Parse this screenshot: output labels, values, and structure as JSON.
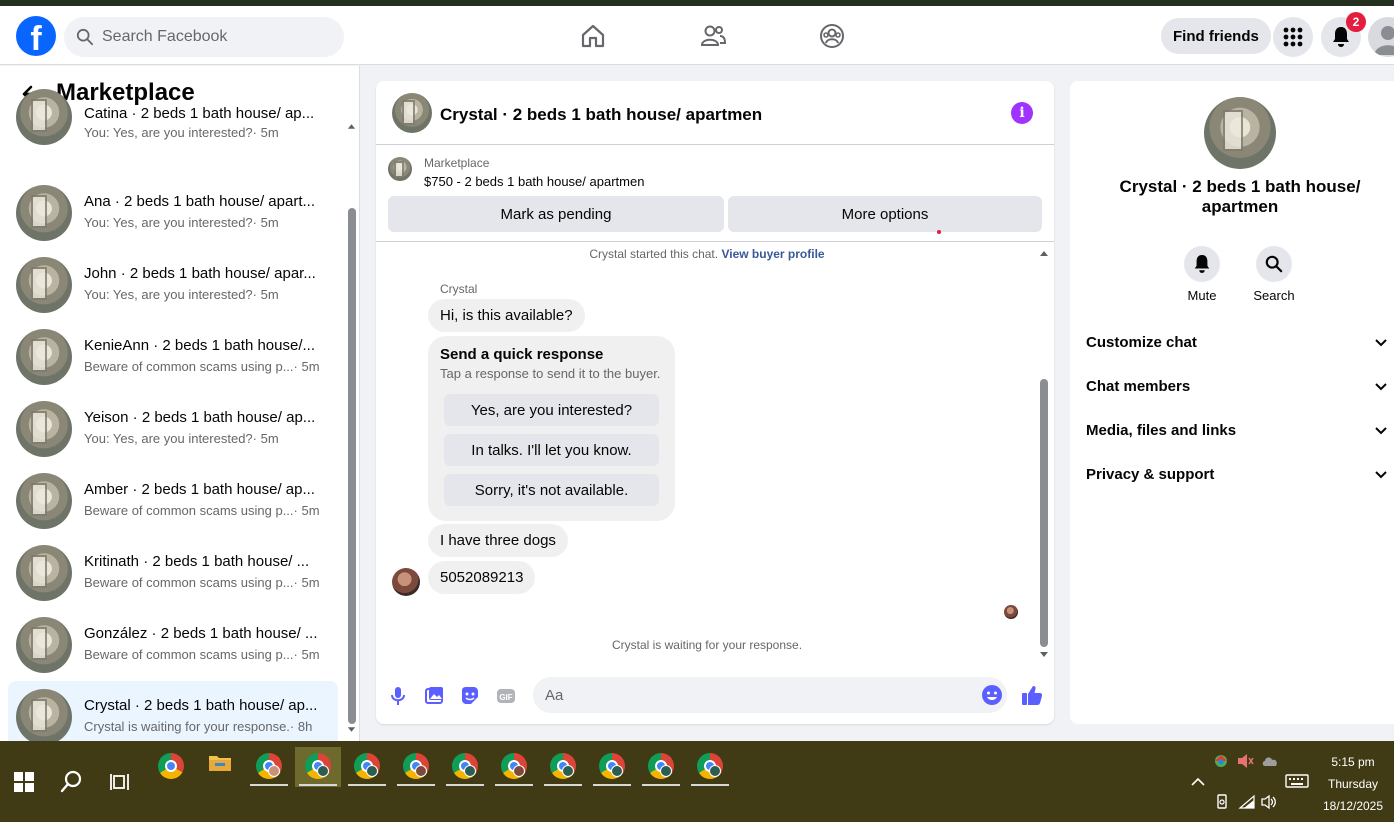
{
  "search": {
    "placeholder": "Search Facebook"
  },
  "header": {
    "find_friends": "Find friends",
    "notifications_count": "2"
  },
  "sidebar": {
    "title": "Marketplace",
    "conversations": [
      {
        "name": "Catina · 2 beds 1 bath house/ ap...",
        "preview": "You: Yes, are you interested?",
        "time": "· 5m",
        "active": false
      },
      {
        "name": "Ana · 2 beds 1 bath house/ apart...",
        "preview": "You: Yes, are you interested?",
        "time": "· 5m",
        "active": false
      },
      {
        "name": "John · 2 beds 1 bath house/ apar...",
        "preview": "You: Yes, are you interested?",
        "time": "· 5m",
        "active": false
      },
      {
        "name": "KenieAnn · 2 beds 1 bath house/...",
        "preview": "Beware of common scams using p...",
        "time": "· 5m",
        "active": false
      },
      {
        "name": "Yeison · 2 beds 1 bath house/ ap...",
        "preview": "You: Yes, are you interested?",
        "time": "· 5m",
        "active": false
      },
      {
        "name": "Amber · 2 beds 1 bath house/ ap...",
        "preview": "Beware of common scams using p...",
        "time": "· 5m",
        "active": false
      },
      {
        "name": "Kritinath · 2 beds 1 bath house/ ...",
        "preview": "Beware of common scams using p...",
        "time": "· 5m",
        "active": false
      },
      {
        "name": "González · 2 beds 1 bath house/ ...",
        "preview": "Beware of common scams using p...",
        "time": "· 5m",
        "active": false
      },
      {
        "name": "Crystal · 2 beds 1 bath house/ ap...",
        "preview": "Crystal is waiting for your response.",
        "time": "· 8h",
        "active": true
      }
    ]
  },
  "chat": {
    "title": "Crystal · 2 beds 1 bath house/ apartmen",
    "marketplace_label": "Marketplace",
    "listing": "$750 - 2 beds 1 bath house/ apartmen",
    "mark_pending": "Mark as pending",
    "more_options": "More options",
    "started_text": "Crystal started this chat.",
    "view_buyer_profile": "View buyer profile",
    "sender": "Crystal",
    "messages": [
      "Hi, is this available?",
      "I have three dogs",
      "5052089213"
    ],
    "quick_response": {
      "title": "Send a quick response",
      "subtitle": "Tap a response to send it to the buyer.",
      "options": [
        "Yes, are you interested?",
        "In talks. I'll let you know.",
        "Sorry, it's not available."
      ]
    },
    "waiting": "Crystal is waiting for your response.",
    "composer_placeholder": "Aa"
  },
  "details": {
    "name": "Crystal · 2 beds 1 bath house/ apartmen",
    "mute": "Mute",
    "search": "Search",
    "sections": [
      "Customize chat",
      "Chat members",
      "Media, files and links",
      "Privacy & support"
    ]
  },
  "taskbar": {
    "time": "5:15 pm",
    "day": "Thursday",
    "date": "18/12/2025"
  },
  "colors": {
    "brand": "#0866ff",
    "accent_purple": "#a033ff",
    "messenger_blue": "#5b5fff",
    "taskbar": "#403b14"
  }
}
